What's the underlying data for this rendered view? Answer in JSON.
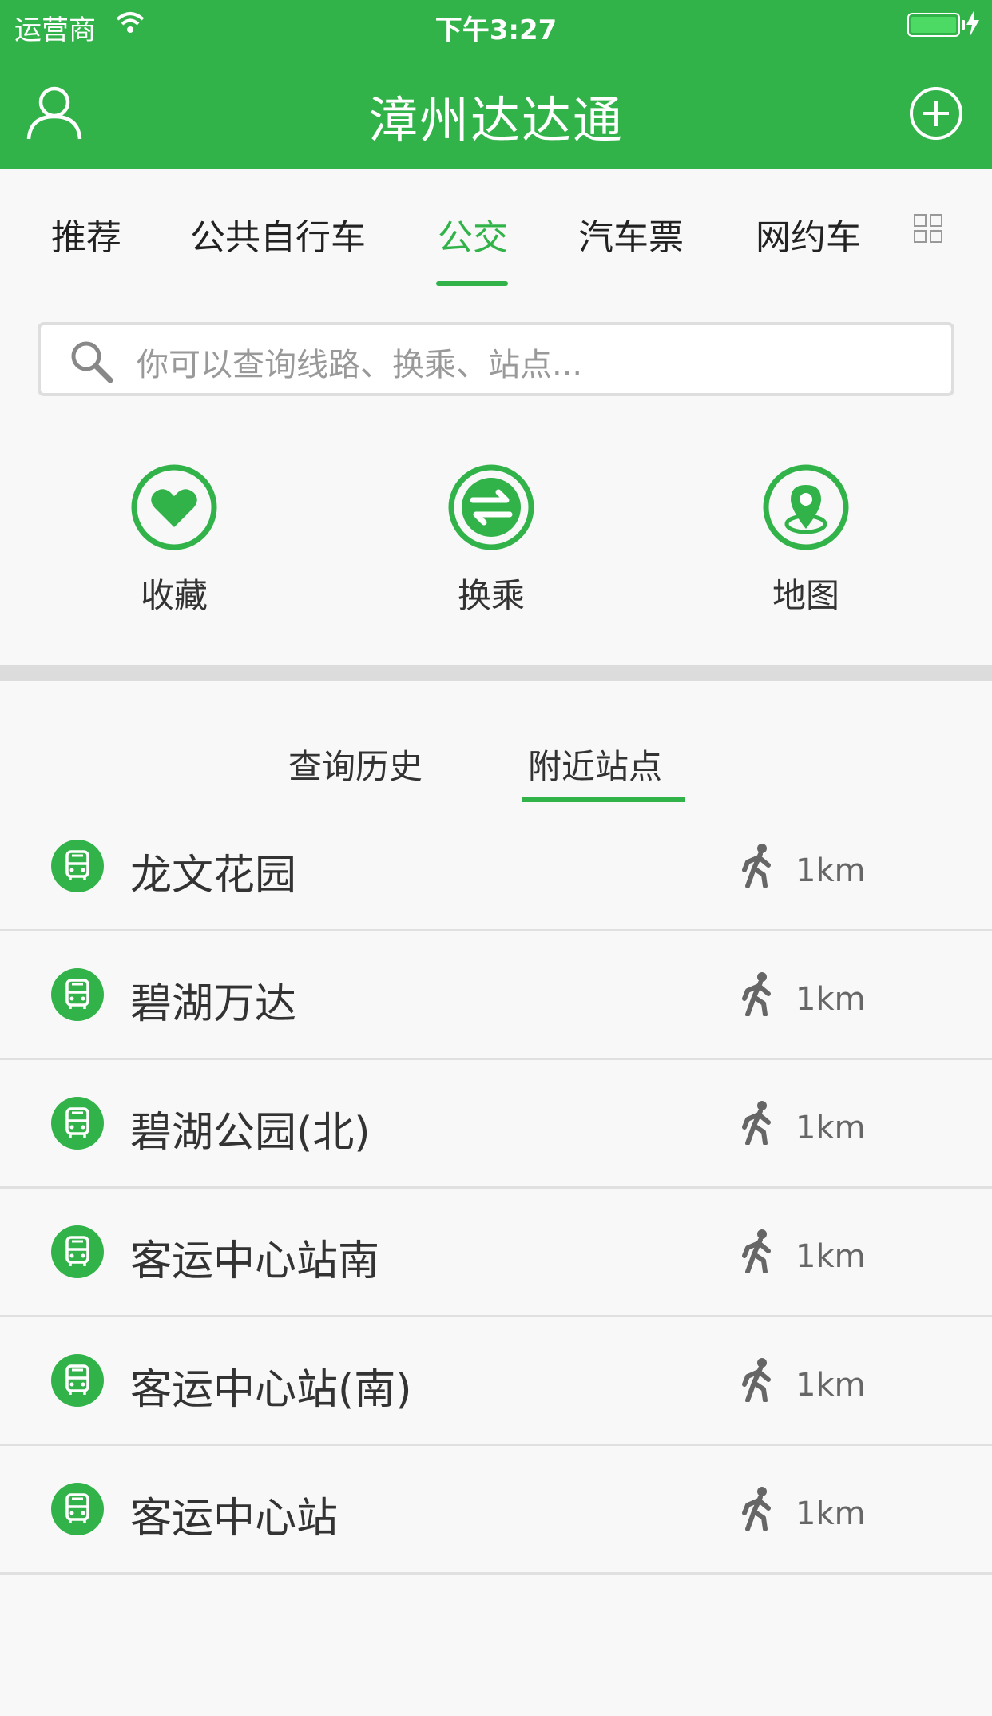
{
  "status_bar": {
    "carrier": "运营商",
    "time": "下午3:27"
  },
  "header": {
    "title": "漳州达达通",
    "brand_color": "#32b34a"
  },
  "tabs": [
    {
      "label": "推荐",
      "active": false
    },
    {
      "label": "公共自行车",
      "active": false
    },
    {
      "label": "公交",
      "active": true
    },
    {
      "label": "汽车票",
      "active": false
    },
    {
      "label": "网约车",
      "active": false
    }
  ],
  "search": {
    "placeholder": "你可以查询线路、换乘、站点..."
  },
  "quick_actions": [
    {
      "label": "收藏",
      "icon": "heart-icon"
    },
    {
      "label": "换乘",
      "icon": "transfer-icon"
    },
    {
      "label": "地图",
      "icon": "map-pin-icon"
    }
  ],
  "subtabs": [
    {
      "label": "查询历史",
      "active": false
    },
    {
      "label": "附近站点",
      "active": true
    }
  ],
  "stations": [
    {
      "name": "龙文花园",
      "distance": "1km"
    },
    {
      "name": "碧湖万达",
      "distance": "1km"
    },
    {
      "name": "碧湖公园(北)",
      "distance": "1km"
    },
    {
      "name": "客运中心站南",
      "distance": "1km"
    },
    {
      "name": "客运中心站(南)",
      "distance": "1km"
    },
    {
      "name": "客运中心站",
      "distance": "1km"
    }
  ]
}
